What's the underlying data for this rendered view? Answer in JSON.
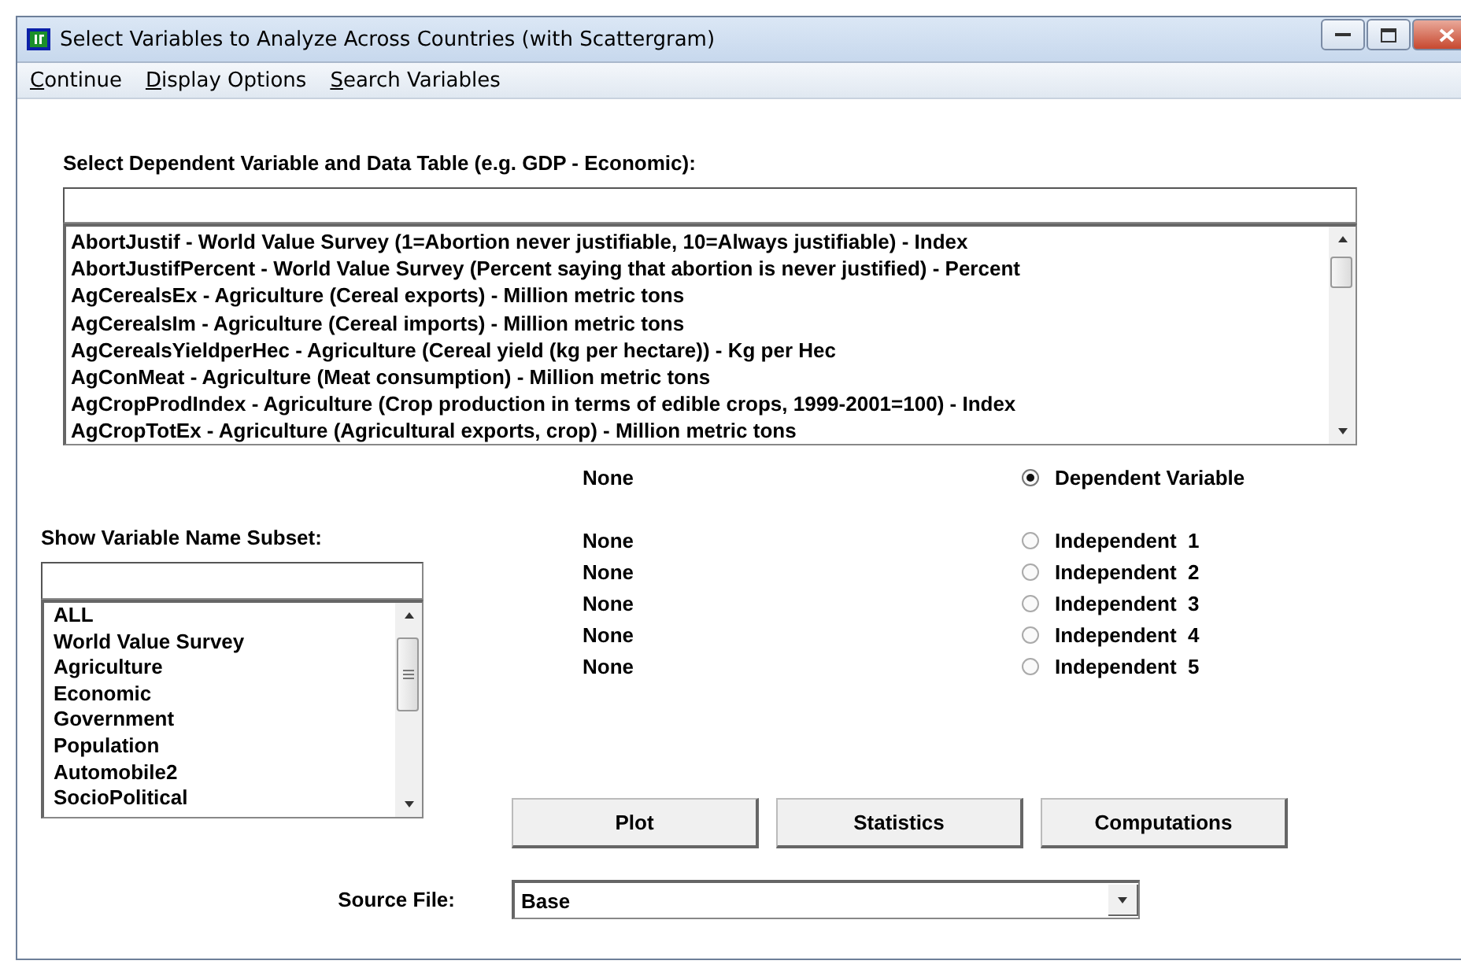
{
  "window": {
    "title": "Select Variables to Analyze Across Countries (with Scattergram)"
  },
  "menu": [
    "Continue",
    "Display Options",
    "Search Variables"
  ],
  "dependent_label": "Select Dependent Variable and Data Table (e.g. GDP - Economic):",
  "variables": [
    "AbortJustif - World Value Survey (1=Abortion never justifiable, 10=Always justifiable) - Index",
    "AbortJustifPercent - World Value Survey (Percent saying that abortion is never justified) - Percent",
    "AgCerealsEx - Agriculture (Cereal exports) - Million metric tons",
    "AgCerealsIm - Agriculture (Cereal imports) - Million metric tons",
    "AgCerealsYieldperHec - Agriculture (Cereal yield (kg per hectare)) - Kg per Hec",
    "AgConMeat - Agriculture (Meat consumption) - Million metric tons",
    "AgCropProdIndex - Agriculture (Crop production in terms of edible crops, 1999-2001=100) - Index",
    "AgCropTotEx - Agriculture (Agricultural exports, crop) - Million metric tons"
  ],
  "subset_label": "Show Variable Name Subset:",
  "subsets": [
    "ALL",
    "World Value Survey",
    "Agriculture",
    "Economic",
    "Government",
    "Population",
    "Automobile2",
    "SocioPolitical"
  ],
  "assignments": [
    {
      "value": "None",
      "label": "Dependent Variable",
      "selected": true
    },
    {
      "value": "None",
      "label": "Independent  1",
      "selected": false
    },
    {
      "value": "None",
      "label": "Independent  2",
      "selected": false
    },
    {
      "value": "None",
      "label": "Independent  3",
      "selected": false
    },
    {
      "value": "None",
      "label": "Independent  4",
      "selected": false
    },
    {
      "value": "None",
      "label": "Independent  5",
      "selected": false
    }
  ],
  "buttons": [
    "Plot",
    "Statistics",
    "Computations"
  ],
  "source_file": {
    "label": "Source File:",
    "value": "Base"
  }
}
